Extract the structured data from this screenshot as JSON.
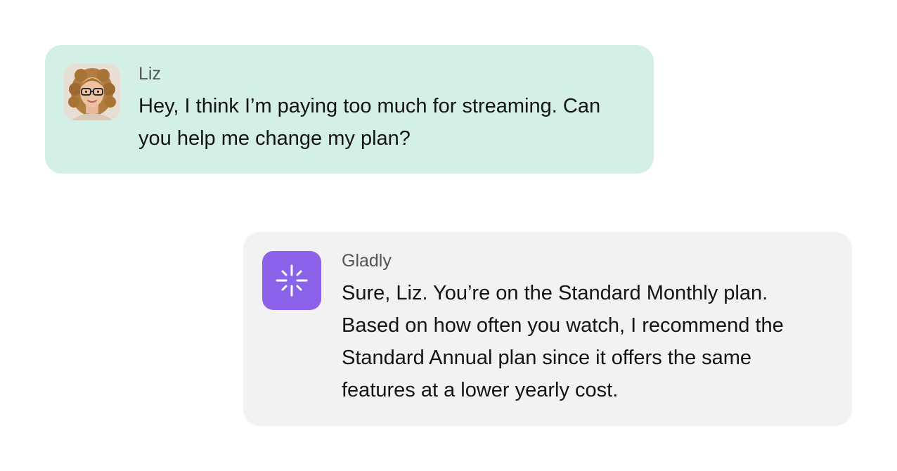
{
  "conversation": {
    "messages": [
      {
        "sender": "Liz",
        "avatar": "user-photo-avatar",
        "text": "Hey, I think I’m paying too much for streaming. Can you help me change my plan?"
      },
      {
        "sender": "Gladly",
        "avatar": "sparkle-icon",
        "text": "Sure, Liz. You’re on the Standard Monthly plan. Based on how often you watch, I recommend the Standard Annual plan since it offers the same features at a lower yearly cost."
      }
    ]
  },
  "colors": {
    "user_bubble": "#d4f0e6",
    "agent_bubble": "#f2f2f2",
    "brand_accent": "#8b63ea",
    "sender_text": "#555555",
    "message_text": "#141414"
  }
}
